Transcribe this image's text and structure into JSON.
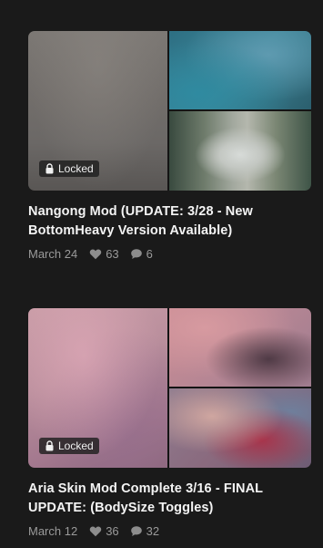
{
  "colors": {
    "background": "#1a1a1a",
    "title_text": "#f4f4f4",
    "meta_text": "#9a9a9a",
    "badge_bg": "#1e1e1e"
  },
  "posts": [
    {
      "locked_label": "Locked",
      "title": "Nangong Mod (UPDATE: 3/28 - New BottomHeavy Version Available)",
      "date": "March 24",
      "likes": "63",
      "comments": "6",
      "icons": [
        "lock-icon",
        "heart-icon",
        "comment-icon"
      ]
    },
    {
      "locked_label": "Locked",
      "title": "Aria Skin Mod Complete 3/16 - FINAL UPDATE: (BodySize Toggles)",
      "date": "March 12",
      "likes": "36",
      "comments": "32",
      "icons": [
        "lock-icon",
        "heart-icon",
        "comment-icon"
      ]
    }
  ]
}
